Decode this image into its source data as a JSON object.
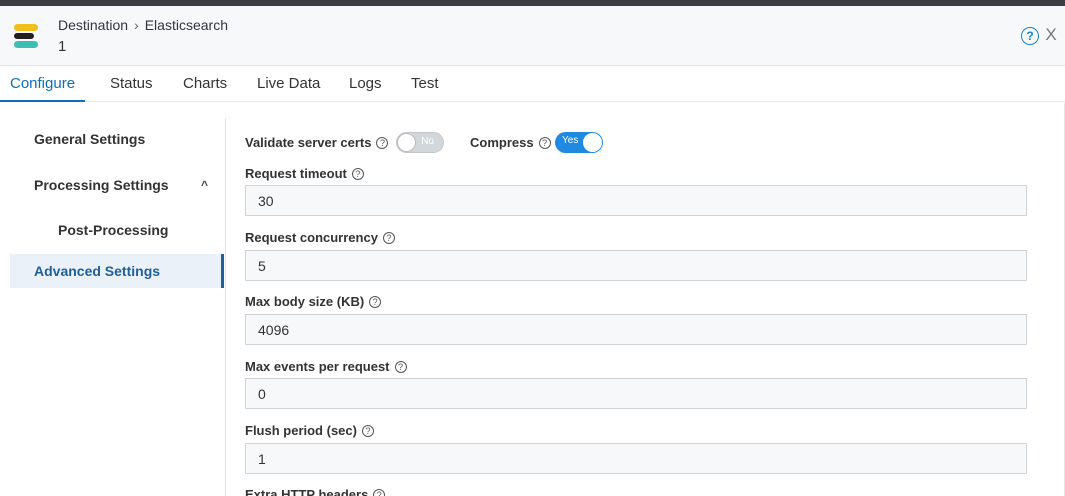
{
  "header": {
    "breadcrumb": [
      "Destination",
      "Elasticsearch"
    ],
    "breadcrumb_separator": "›",
    "subtitle": "1",
    "help_icon": "?",
    "close_icon": "X"
  },
  "tabs": [
    {
      "label": "Configure",
      "active": true
    },
    {
      "label": "Status"
    },
    {
      "label": "Charts"
    },
    {
      "label": "Live Data"
    },
    {
      "label": "Logs"
    },
    {
      "label": "Test"
    }
  ],
  "sidebar": {
    "items": [
      {
        "label": "General Settings"
      },
      {
        "label": "Processing Settings",
        "expanded": true,
        "chevron": "^"
      },
      {
        "label": "Post-Processing"
      },
      {
        "label": "Advanced Settings",
        "active": true
      }
    ]
  },
  "form": {
    "validate_certs": {
      "label": "Validate server certs",
      "state": "No"
    },
    "compress": {
      "label": "Compress",
      "state": "Yes"
    },
    "help_glyph": "?",
    "request_timeout": {
      "label": "Request timeout",
      "value": "30"
    },
    "request_concurrency": {
      "label": "Request concurrency",
      "value": "5"
    },
    "max_body_size": {
      "label": "Max body size (KB)",
      "value": "4096"
    },
    "max_events": {
      "label": "Max events per request",
      "value": "0"
    },
    "flush_period": {
      "label": "Flush period (sec)",
      "value": "1"
    },
    "extra_headers": {
      "label": "Extra HTTP headers"
    }
  },
  "colors": {
    "accent": "#0f6fb2",
    "toggle_on": "#1f8ae0",
    "active_side": "#1f5f9c"
  }
}
